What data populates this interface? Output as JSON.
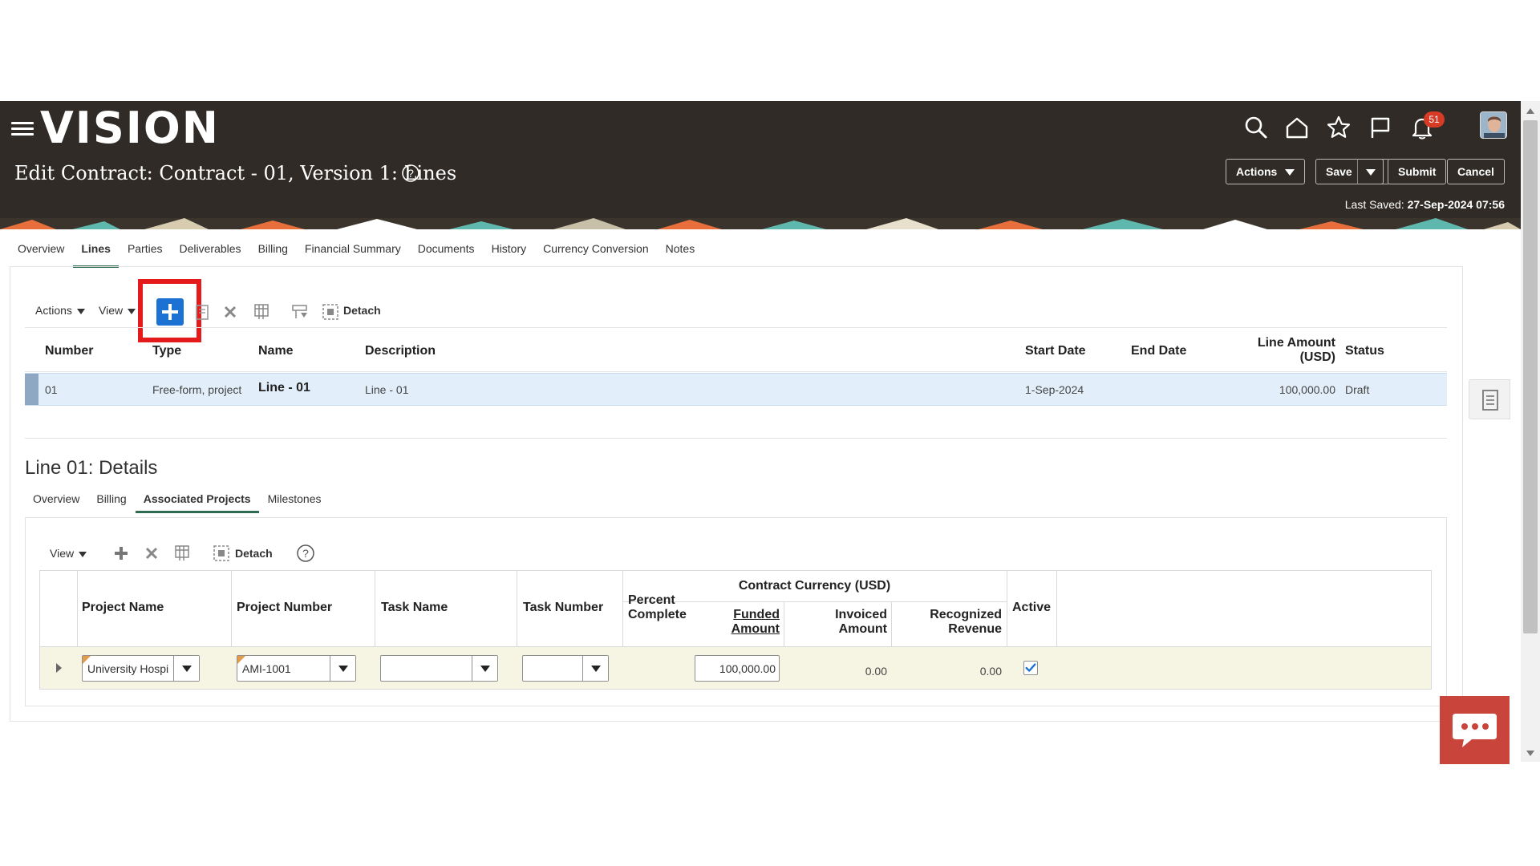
{
  "app": {
    "logo": "VISION",
    "notifications_count": "51",
    "page_title": "Edit Contract: Contract - 01, Version 1: Lines",
    "buttons": {
      "actions": "Actions",
      "save": "Save",
      "submit": "Submit",
      "cancel": "Cancel"
    },
    "last_saved_label": "Last Saved:",
    "last_saved_value": "27-Sep-2024 07:56",
    "icons": [
      "menu-icon",
      "search-icon",
      "home-icon",
      "favorites-star-icon",
      "flag-icon",
      "bell-icon",
      "help-icon"
    ]
  },
  "tabs": [
    "Overview",
    "Lines",
    "Parties",
    "Deliverables",
    "Billing",
    "Financial Summary",
    "Documents",
    "History",
    "Currency Conversion",
    "Notes"
  ],
  "active_tab": "Lines",
  "lines_toolbar": {
    "actions": "Actions",
    "view": "View",
    "detach": "Detach"
  },
  "lines_table": {
    "headers": {
      "number": "Number",
      "type": "Type",
      "name": "Name",
      "description": "Description",
      "start_date": "Start Date",
      "end_date": "End Date",
      "line_amount_1": "Line Amount",
      "line_amount_2": "(USD)",
      "status": "Status"
    },
    "rows": [
      {
        "number": "01",
        "type": "Free-form, project",
        "name": "Line - 01",
        "description": "Line - 01",
        "start_date": "1-Sep-2024",
        "end_date": "",
        "line_amount": "100,000.00",
        "status": "Draft"
      }
    ]
  },
  "details": {
    "title": "Line 01: Details",
    "tabs": [
      "Overview",
      "Billing",
      "Associated Projects",
      "Milestones"
    ],
    "active_tab": "Associated Projects",
    "toolbar": {
      "view": "View",
      "detach": "Detach"
    },
    "grid": {
      "headers": {
        "project_name": "Project Name",
        "project_number": "Project Number",
        "task_name": "Task Name",
        "task_number": "Task Number",
        "percent_complete_1": "Percent",
        "percent_complete_2": "Complete",
        "contract_currency": "Contract Currency (USD)",
        "funded_1": "Funded",
        "funded_2": "Amount",
        "invoiced_1": "Invoiced",
        "invoiced_2": "Amount",
        "recognized_1": "Recognized",
        "recognized_2": "Revenue",
        "active": "Active"
      },
      "rows": [
        {
          "project_name": "University Hospi",
          "project_number": "AMI-1001",
          "task_name": "",
          "task_number": "",
          "percent_complete": "",
          "funded_amount": "100,000.00",
          "invoiced_amount": "0.00",
          "recognized_revenue": "0.00",
          "active": true
        }
      ]
    }
  },
  "colors": {
    "header_bg": "#302b26",
    "accent_tab_underline": "#2d6c50",
    "add_button_blue": "#1b72d3",
    "highlight_red": "#e51b1b",
    "selected_row": "#e2effa",
    "chat_button": "#c9443a"
  }
}
